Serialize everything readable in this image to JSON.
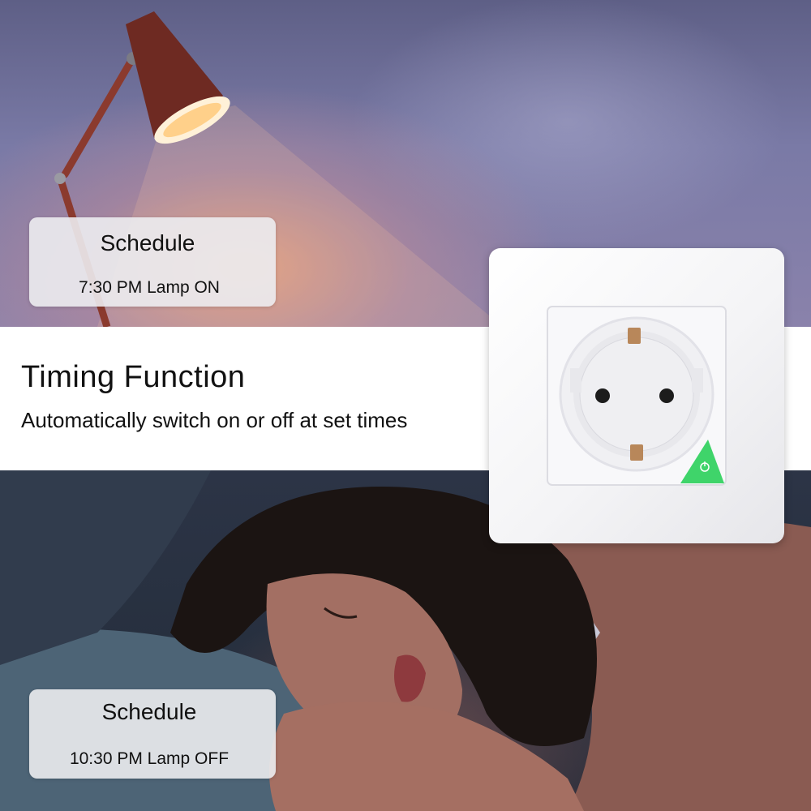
{
  "schedule_on": {
    "title": "Schedule",
    "line": "7:30 PM Lamp ON"
  },
  "banner": {
    "title": "Timing Function",
    "subtitle": "Automatically switch on or off at set times"
  },
  "schedule_off": {
    "title": "Schedule",
    "line": "10:30 PM Lamp OFF"
  },
  "colors": {
    "banner_bg": "#ffffff",
    "card_bg": "#ececf0",
    "socket_white": "#f4f4f6",
    "power_green": "#3fd46a",
    "lamp_red": "#6e2a22"
  },
  "icons": {
    "socket": "schuko-socket-icon",
    "power": "power-icon",
    "lamp": "desk-lamp-icon"
  }
}
